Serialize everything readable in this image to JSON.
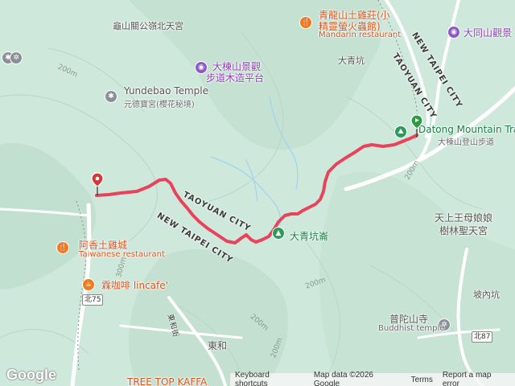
{
  "map": {
    "colors": {
      "terrain": "#cfe8dc",
      "ridge": "#b5d8c6",
      "road": "#ffffff",
      "water": "#9fd3f0",
      "track": "#e8435a",
      "start_flag": "#2e9a40",
      "end_pin": "#d23a3a"
    }
  },
  "pois": {
    "guishan_temple": "龜山關公嶺北天宮",
    "qinglong_restaurant_line1": "青龍山土雞莊(小",
    "qinglong_restaurant_line2": "精靈螢火蟲館)",
    "mandarin_restaurant": "Mandarin restaurant",
    "datong_viewpoint": "大同山觀景",
    "dadong_lookout_line1": "大棟山景觀",
    "dadong_lookout_line2": "步道木造平台",
    "daqingkeng_top": "大青坑",
    "yundebao_en": "Yundebao Temple",
    "yundebao_zh": "元德寶宮(櫻花秘境)",
    "datong_trail_en": "Datong Mountain Tra",
    "datong_trail_zh": "大棟山登山步道",
    "tianshang_temple_line1": "天上王母娘娘",
    "tianshang_temple_line2": "樹林聖天宮",
    "daqingkeng_mountain": "大青坑崙",
    "axiang_zh": "阿香土雞城",
    "axiang_en": "Taiwanese restaurant",
    "lincafe": "霖咖啡 lincafe'",
    "ponei_keng": "坡內坑",
    "putuo_zh": "普陀山寺",
    "putuo_en": "Buddhist temple",
    "donghe": "東和",
    "treetop_partial": "TREE TOP KAFFA"
  },
  "roads": {
    "taoyuan_city_upper": "TAOYUAN CITY",
    "new_taipei_city_upper": "NEW TAIPEI CITY",
    "taoyuan_city_lower": "TAOYUAN CITY",
    "new_taipei_city_lower": "NEW TAIPEI CITY",
    "donghe_street": "東和街",
    "route_bei75": "北75",
    "route_bei87": "北87"
  },
  "contours": {
    "c1": "200m",
    "c2": "200m",
    "c3": "200m",
    "c4": "200m",
    "c5": "300m",
    "c6": "200m"
  },
  "icons": {
    "temple": "temple-icon",
    "restaurant": "restaurant-icon",
    "viewpoint": "camera-icon",
    "hiking": "hiking-icon",
    "cafe": "cafe-icon",
    "buddhist": "dharma-wheel-icon",
    "peak": "peak-icon"
  },
  "footer": {
    "google": "Google",
    "keyboard": "Keyboard shortcuts",
    "map_data": "Map data ©2026 Google",
    "terms": "Terms",
    "report": "Report a map error"
  }
}
